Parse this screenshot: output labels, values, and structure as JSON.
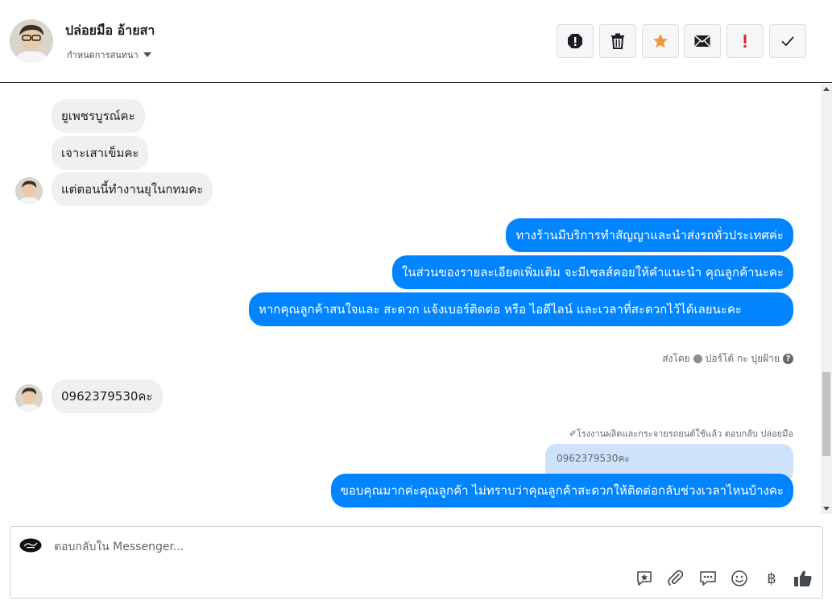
{
  "header": {
    "name": "ปล่อยมือ อ้ายสา",
    "subtitle": "กำหนดการสนทนา",
    "actions": [
      {
        "name": "report-icon",
        "color": "#1c1e21"
      },
      {
        "name": "trash-icon",
        "color": "#1c1e21"
      },
      {
        "name": "star-icon",
        "color": "#f7923b"
      },
      {
        "name": "mail-icon",
        "color": "#1c1e21"
      },
      {
        "name": "spam-icon",
        "color": "#e02020"
      },
      {
        "name": "check-icon",
        "color": "#1c1e21"
      }
    ]
  },
  "conversation": {
    "incoming_1": "ยูเพชรบูรณ์คะ",
    "incoming_2": "เจาะเสาเข็มคะ",
    "incoming_3": "แต่ตอนนี้ทำงานยุในกทมคะ",
    "outgoing_1": "ทางร้านมีบริการทำสัญญาและนำส่งรถทั่วประเทศค่ะ",
    "outgoing_2": "ในส่วนของรายละเอียดเพิ่มเติม จะมีเซลส์คอยให้คำแนะนำ คุณลูกค้านะคะ",
    "outgoing_3": "หากคุณลูกค้าสนใจและ สะดวก แจ้งเบอร์ติดต่อ หรือ ไอดีไลน์ และเวลาที่สะดวกไว้ได้เลยนะคะ",
    "sent_by": "ส่งโดย",
    "sender": "ปอร์โต้ กะ ปุยฝ้าย",
    "incoming_4": "0962379530คะ",
    "reply_note": "✐โรงงานผลิตและกระจายรถยนต์ใช้แล้ว ตอบกลับ ปล่อยมือ",
    "quoted": "0962379530คะ",
    "outgoing_4": "ขอบคุณมากค่ะคุณลูกค้า ไม่ทราบว่าคุณลูกค้าสะดวกให้ติดต่อกลับช่วงเวลาไหนบ้างคะ"
  },
  "composer": {
    "placeholder": "ตอบกลับใน Messenger...",
    "tools": [
      "saved-reply-icon",
      "attach-icon",
      "quick-reply-icon",
      "emoji-icon",
      "baht-icon",
      "like-icon"
    ],
    "baht": "฿"
  },
  "colors": {
    "outgoing_bubble": "#0084ff",
    "incoming_bubble": "#f0f0f0",
    "quote_bg": "#cfe2fb"
  }
}
